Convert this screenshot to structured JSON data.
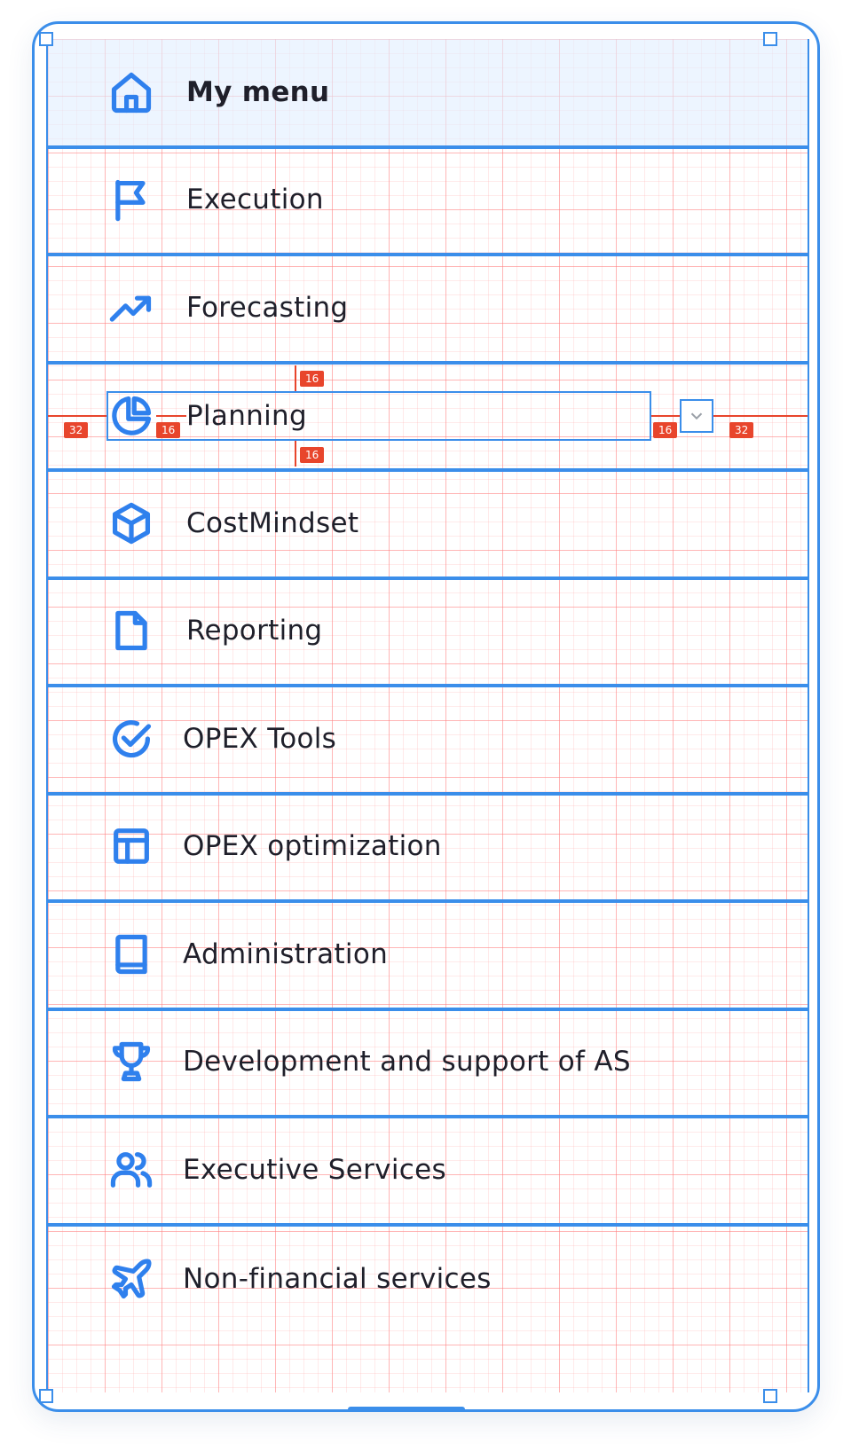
{
  "menu": {
    "items": [
      {
        "label": "My menu",
        "icon": "home-icon"
      },
      {
        "label": "Execution",
        "icon": "flag-icon"
      },
      {
        "label": "Forecasting",
        "icon": "trending-up-icon"
      },
      {
        "label": "Planning",
        "icon": "pie-chart-icon"
      },
      {
        "label": "CostMindset",
        "icon": "box-icon"
      },
      {
        "label": "Reporting",
        "icon": "file-icon"
      },
      {
        "label": "OPEX Tools",
        "icon": "check-circle-icon"
      },
      {
        "label": "OPEX optimization",
        "icon": "layout-icon"
      },
      {
        "label": "Administration",
        "icon": "book-icon"
      },
      {
        "label": "Development and support of AS",
        "icon": "trophy-icon"
      },
      {
        "label": "Executive Services",
        "icon": "users-icon"
      },
      {
        "label": "Non-financial services",
        "icon": "plane-icon"
      }
    ],
    "active_item": "My menu",
    "selected_item": "Planning",
    "expand_icon": "chevron-down-icon"
  },
  "measurements": {
    "top": "16",
    "bottom": "16",
    "left_outer": "32",
    "left_inner": "16",
    "right_inner": "16",
    "right_outer": "32"
  },
  "colors": {
    "accent": "#2f80ed",
    "outline": "#3b8eea",
    "redline": "#e8452c",
    "text": "#1f1f2a"
  }
}
